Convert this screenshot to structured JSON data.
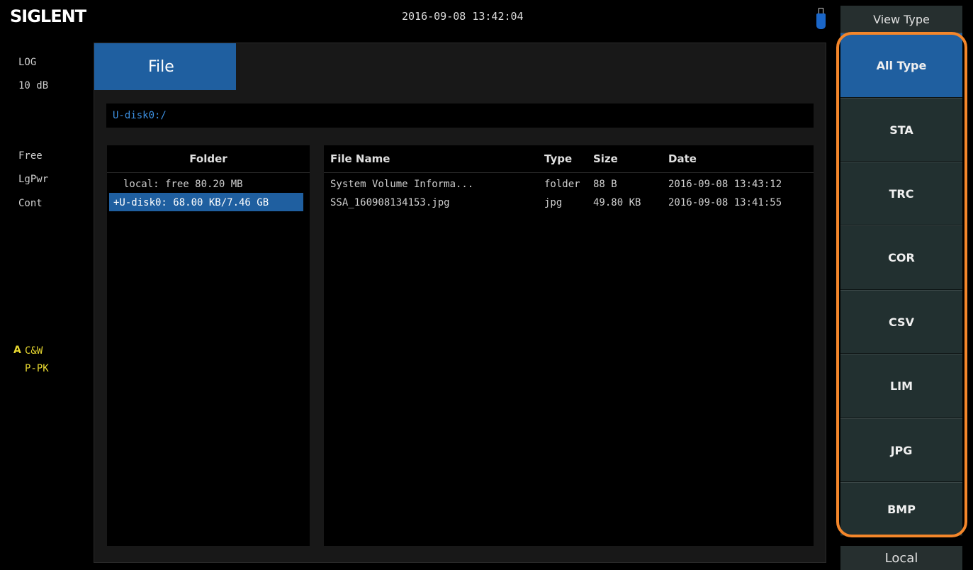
{
  "header": {
    "logo": "SIGLENT",
    "datetime": "2016-09-08  13:42:04"
  },
  "left_status": {
    "scale_type": "LOG",
    "scale_div": "10 dB",
    "trigger": "Free",
    "avg_type": "LgPwr",
    "sweep": "Cont",
    "trace_letter": "A",
    "trace_mode": "C&W",
    "detector": "P-PK"
  },
  "file_panel": {
    "tab": "File",
    "path": "U-disk0:/",
    "folder_header": "Folder",
    "folders": [
      "local: free 80.20 MB",
      "+U-disk0: 68.00 KB/7.46 GB"
    ],
    "columns": {
      "name": "File Name",
      "type": "Type",
      "size": "Size",
      "date": "Date"
    },
    "files": [
      {
        "name": "System Volume Informa...",
        "type": "folder",
        "size": "88 B",
        "date": "2016-09-08 13:43:12"
      },
      {
        "name": "SSA_160908134153.jpg",
        "type": "jpg",
        "size": "49.80 KB",
        "date": "2016-09-08 13:41:55"
      }
    ]
  },
  "softkeys": {
    "title": "View Type",
    "items": [
      "All Type",
      "STA",
      "TRC",
      "COR",
      "CSV",
      "LIM",
      "JPG",
      "BMP"
    ],
    "selected": "All Type",
    "bottom": "Local"
  },
  "colors": {
    "accent": "#1f5fa0",
    "highlight": "#f4862a",
    "trace": "#e8d830"
  }
}
